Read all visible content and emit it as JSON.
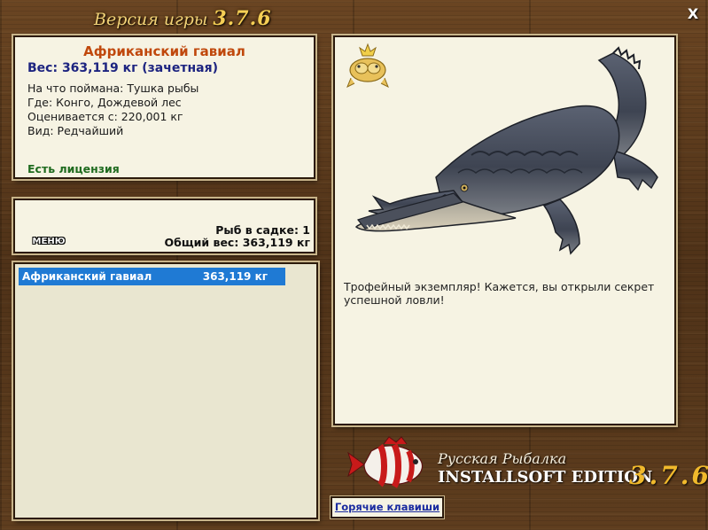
{
  "window": {
    "title": "Версия игры",
    "version": "3.7.6",
    "close_label": "X"
  },
  "fish_info": {
    "name": "Африканский гавиал",
    "weight_line": "Вес: 363,119 кг (зачетная)",
    "caught_on": "На что поймана: Тушка рыбы",
    "location": "Где: Конго, Дождевой лес",
    "valued_from": "Оценивается с: 220,001 кг",
    "rarity": "Вид: Редчайший",
    "license": "Есть лицензия"
  },
  "cage": {
    "menu_label": "МЕНЮ",
    "count_line": "Рыб в садке: 1",
    "total_weight_line": "Общий вес: 363,119 кг"
  },
  "catch_list": [
    {
      "name": "Африканский гавиал",
      "weight": "363,119 кг"
    }
  ],
  "preview": {
    "description": "Трофейный экземпляр! Кажется, вы открыли секрет успешной ловли!"
  },
  "branding": {
    "line1": "Русская Рыбалка",
    "line2": "INSTALLSOFT EDITION",
    "version": "3.7.6"
  },
  "hotkeys_label": "Горячие клавиши",
  "icons": {
    "close": "close-icon",
    "trophy": "trophy-fish-badge-icon",
    "brand_fish": "brand-fish-logo"
  },
  "colors": {
    "fish_name": "#c0480c",
    "weight": "#1d2480",
    "license": "#1f6b1f",
    "selection": "#1f7ad4",
    "panel_bg": "#f6f3e3",
    "version_gold": "#f0b92c"
  }
}
